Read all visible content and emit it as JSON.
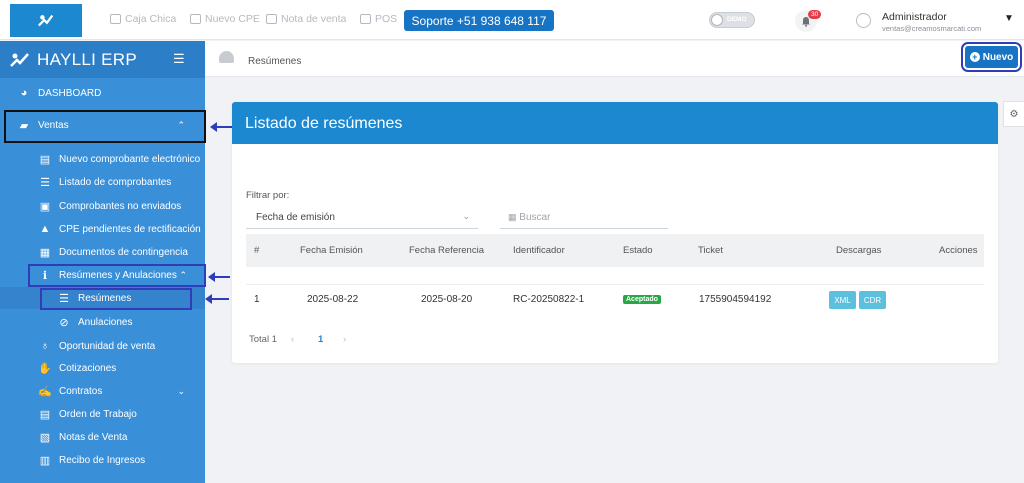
{
  "topbar": {
    "links": [
      "Caja Chica",
      "Nuevo CPE",
      "Nota de venta",
      "POS"
    ],
    "support": "Soporte +51 938 648 117",
    "demo_label": "DEMO",
    "notif_count": "30",
    "user_name": "Administrador",
    "user_email": "ventas@creamosmarcati.com"
  },
  "sidebar": {
    "brand": "HAYLLI ERP",
    "items": [
      {
        "label": "DASHBOARD",
        "icon": "dashboard-icon"
      },
      {
        "label": "Ventas",
        "icon": "sales-icon"
      },
      {
        "label": "Nuevo comprobante electrónico",
        "icon": "file-icon"
      },
      {
        "label": "Listado de comprobantes",
        "icon": "list-icon"
      },
      {
        "label": "Comprobantes no enviados",
        "icon": "inbox-icon"
      },
      {
        "label": "CPE pendientes de rectificación",
        "icon": "warning-icon"
      },
      {
        "label": "Documentos de contingencia",
        "icon": "clipboard-icon"
      },
      {
        "label": "Resúmenes y Anulaciones",
        "icon": "info-icon"
      },
      {
        "label": "Resúmenes",
        "icon": "list-icon"
      },
      {
        "label": "Anulaciones",
        "icon": "ban-icon"
      },
      {
        "label": "Oportunidad de venta",
        "icon": "lightbulb-icon"
      },
      {
        "label": "Cotizaciones",
        "icon": "hand-icon"
      },
      {
        "label": "Contratos",
        "icon": "handshake-icon"
      },
      {
        "label": "Orden de Trabajo",
        "icon": "file-icon"
      },
      {
        "label": "Notas de Venta",
        "icon": "note-icon"
      },
      {
        "label": "Recibo de Ingresos",
        "icon": "receipt-icon"
      }
    ]
  },
  "breadcrumb": "Resúmenes",
  "nuevo_label": "Nuevo",
  "card": {
    "title": "Listado de resúmenes",
    "filter_label": "Filtrar por:",
    "filter_value": "Fecha de emisión",
    "search_placeholder": "Buscar",
    "columns": [
      "#",
      "Fecha Emisión",
      "Fecha Referencia",
      "Identificador",
      "Estado",
      "Ticket",
      "Descargas",
      "Acciones"
    ],
    "row": {
      "num": "1",
      "fecha_emision": "2025-08-22",
      "fecha_ref": "2025-08-20",
      "identificador": "RC-20250822-1",
      "estado": "Aceptado",
      "ticket": "1755904594192",
      "btn_xml": "XML",
      "btn_cdr": "CDR"
    },
    "pager": {
      "total": "Total 1",
      "page": "1"
    }
  },
  "colors": {
    "primary": "#1b88d0",
    "sidebar": "#3a8fd9",
    "annotation": "#2f3db8",
    "success": "#28a745"
  }
}
